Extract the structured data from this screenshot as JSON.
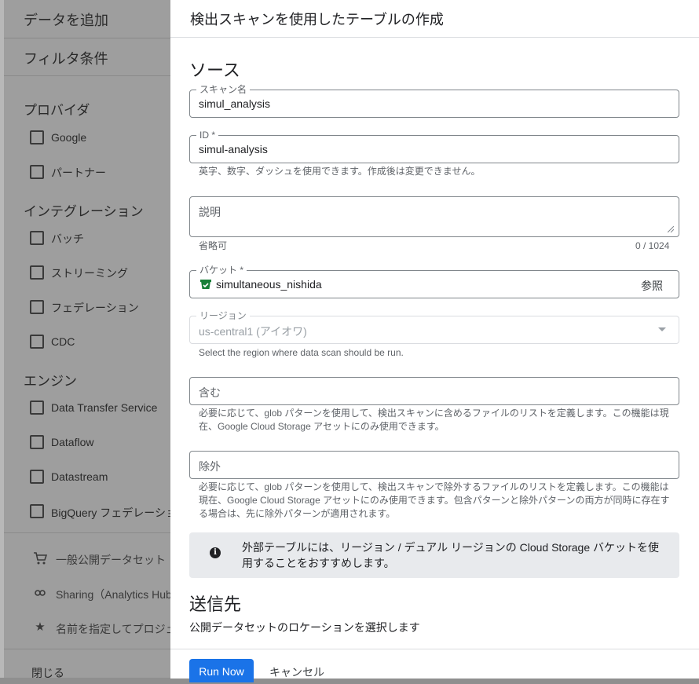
{
  "left": {
    "add_data": "データを追加",
    "filter": "フィルタ条件",
    "provider": {
      "title": "プロバイダ",
      "items": [
        "Google",
        "パートナー"
      ]
    },
    "integration": {
      "title": "インテグレーション",
      "items": [
        "バッチ",
        "ストリーミング",
        "フェデレーション",
        "CDC"
      ]
    },
    "engine": {
      "title": "エンジン",
      "items": [
        "Data Transfer Service",
        "Dataflow",
        "Datastream",
        "BigQuery フェデレーション"
      ]
    },
    "links": [
      "一般公開データセット",
      "Sharing（Analytics Hub）",
      "名前を指定してプロジェクト"
    ],
    "close": "閉じる"
  },
  "drawer": {
    "title": "検出スキャンを使用したテーブルの作成",
    "source_heading": "ソース",
    "scan_name": {
      "label": "スキャン名",
      "value": "simul_analysis"
    },
    "id": {
      "label": "ID *",
      "value": "simul-analysis",
      "hint": "英字、数字、ダッシュを使用できます。作成後は変更できません。"
    },
    "description": {
      "placeholder": "説明",
      "hint": "省略可",
      "counter": "0 / 1024"
    },
    "bucket": {
      "label": "バケット *",
      "value": "simultaneous_nishida",
      "browse": "参照"
    },
    "region": {
      "label": "リージョン",
      "value": "us-central1 (アイオワ)",
      "hint": "Select the region where data scan should be run."
    },
    "include": {
      "placeholder": "含む",
      "hint": "必要に応じて、glob パターンを使用して、検出スキャンに含めるファイルのリストを定義します。この機能は現在、Google Cloud Storage アセットにのみ使用できます。"
    },
    "exclude": {
      "placeholder": "除外",
      "hint": "必要に応じて、glob パターンを使用して、検出スキャンで除外するファイルのリストを定義します。この機能は現在、Google Cloud Storage アセットにのみ使用できます。包含パターンと除外パターンの両方が同時に存在する場合は、先に除外パターンが適用されます。"
    },
    "info": "外部テーブルには、リージョン / デュアル リージョンの Cloud Storage バケットを使用することをおすすめします。",
    "dest_heading": "送信先",
    "dest_desc": "公開データセットのロケーションを選択します",
    "run_now": "Run Now",
    "cancel": "キャンセル"
  },
  "colors": {
    "primary": "#1a73e8",
    "bucket_icon": "#188038"
  }
}
